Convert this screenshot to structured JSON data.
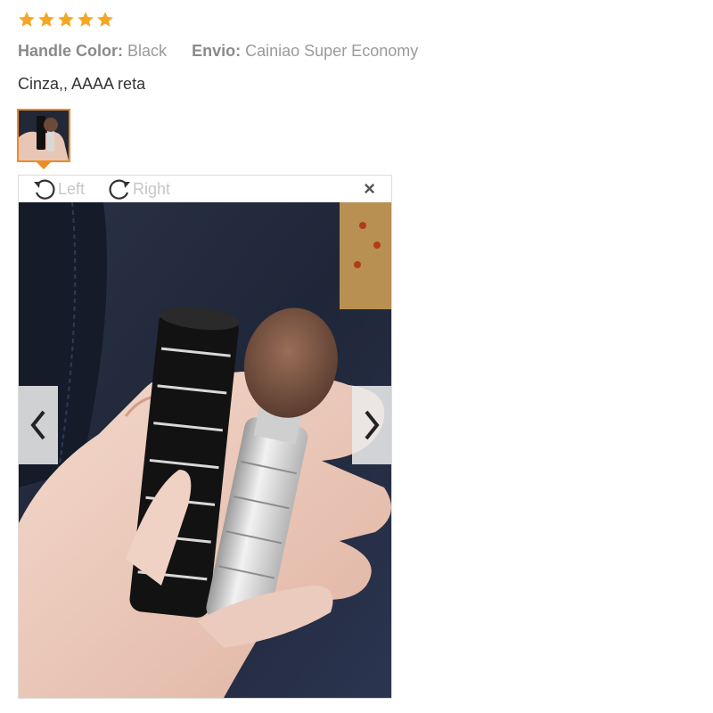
{
  "rating": {
    "stars": 5,
    "max": 5,
    "color": "#f5a623"
  },
  "attributes": [
    {
      "key": "Handle Color:",
      "value": "Black"
    },
    {
      "key": "Envio:",
      "value": "Cainiao Super Economy"
    }
  ],
  "review_text": "Cinza,, AAAA reta",
  "viewer": {
    "rotate_left_label": "Left",
    "rotate_right_label": "Right",
    "close_symbol": "×",
    "icons": {
      "rotate_left": "rotate-left-icon",
      "rotate_right": "rotate-right-icon",
      "prev": "chevron-left-icon",
      "next": "chevron-right-icon",
      "close": "close-icon"
    }
  },
  "colors": {
    "accent": "#f08a24",
    "star": "#f5a623"
  }
}
